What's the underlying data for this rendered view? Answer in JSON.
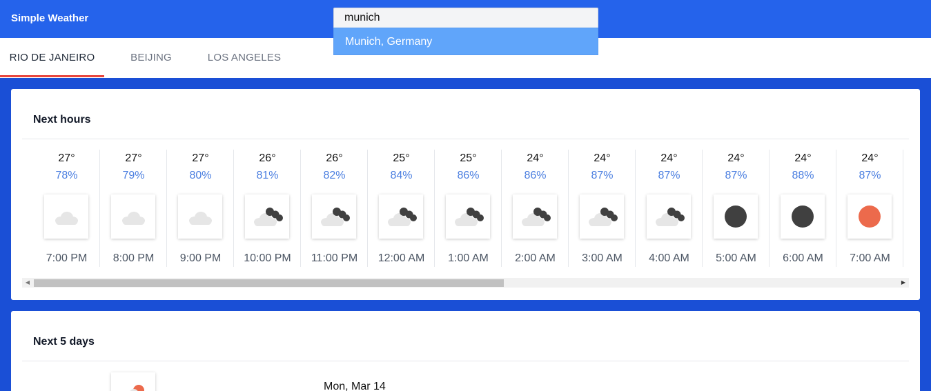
{
  "app": {
    "title": "Simple Weather"
  },
  "search": {
    "value": "munich",
    "suggestions": [
      "Munich, Germany"
    ]
  },
  "tabs": [
    {
      "label": "RIO DE JANEIRO",
      "active": true
    },
    {
      "label": "BEIJING",
      "active": false
    },
    {
      "label": "LOS ANGELES",
      "active": false
    }
  ],
  "next_hours": {
    "title": "Next hours",
    "items": [
      {
        "temp": "27°",
        "humidity": "78%",
        "icon": "cloud-icon",
        "time": "7:00 PM"
      },
      {
        "temp": "27°",
        "humidity": "79%",
        "icon": "cloud-icon",
        "time": "8:00 PM"
      },
      {
        "temp": "27°",
        "humidity": "80%",
        "icon": "cloud-icon",
        "time": "9:00 PM"
      },
      {
        "temp": "26°",
        "humidity": "81%",
        "icon": "cloudy-night-icon",
        "time": "10:00 PM"
      },
      {
        "temp": "26°",
        "humidity": "82%",
        "icon": "cloudy-night-icon",
        "time": "11:00 PM"
      },
      {
        "temp": "25°",
        "humidity": "84%",
        "icon": "cloudy-night-icon",
        "time": "12:00 AM"
      },
      {
        "temp": "25°",
        "humidity": "86%",
        "icon": "cloudy-night-icon",
        "time": "1:00 AM"
      },
      {
        "temp": "24°",
        "humidity": "86%",
        "icon": "cloudy-night-icon",
        "time": "2:00 AM"
      },
      {
        "temp": "24°",
        "humidity": "87%",
        "icon": "cloudy-night-icon",
        "time": "3:00 AM"
      },
      {
        "temp": "24°",
        "humidity": "87%",
        "icon": "cloudy-night-icon",
        "time": "4:00 AM"
      },
      {
        "temp": "24°",
        "humidity": "87%",
        "icon": "clear-night-icon",
        "time": "5:00 AM"
      },
      {
        "temp": "24°",
        "humidity": "88%",
        "icon": "clear-night-icon",
        "time": "6:00 AM"
      },
      {
        "temp": "24°",
        "humidity": "87%",
        "icon": "sun-icon",
        "time": "7:00 AM"
      }
    ]
  },
  "next_days": {
    "title": "Next 5 days",
    "items": [
      {
        "date": "Mon, Mar 14",
        "icon": "partly-cloudy-day-icon"
      }
    ]
  },
  "colors": {
    "appbar": "#2563eb",
    "background": "#1a4fd6",
    "suggestion": "#60a5fa",
    "tab_indicator": "#e8453c",
    "humidity": "#4a7ee0",
    "sun": "#ec6a4c",
    "moon": "#404040",
    "cloud": "#e6e6e6"
  }
}
